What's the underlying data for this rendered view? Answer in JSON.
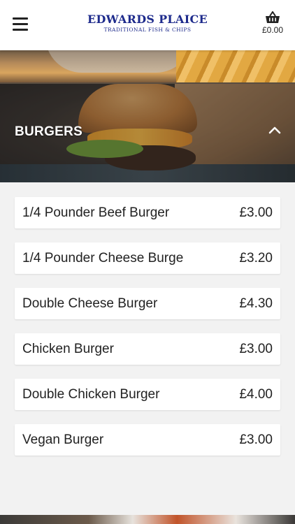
{
  "header": {
    "logo_title": "EDWARDS PLAICE",
    "logo_subtitle": "TRADITIONAL FISH & CHIPS",
    "cart_total": "£0.00",
    "brand_color": "#1e2b8c",
    "icons": {
      "menu": "hamburger-menu-icon",
      "cart": "shopping-basket-icon"
    }
  },
  "category": {
    "title": "BURGERS",
    "expanded": true,
    "toggle_icon": "chevron-up-icon"
  },
  "items": [
    {
      "name": "1/4 Pounder Beef Burger",
      "price": "£3.00"
    },
    {
      "name": "1/4 Pounder Cheese Burge",
      "price": "£3.20"
    },
    {
      "name": "Double Cheese Burger",
      "price": "£4.30"
    },
    {
      "name": "Chicken Burger",
      "price": "£3.00"
    },
    {
      "name": "Double Chicken Burger",
      "price": "£4.00"
    },
    {
      "name": "Vegan Burger",
      "price": "£3.00"
    }
  ]
}
